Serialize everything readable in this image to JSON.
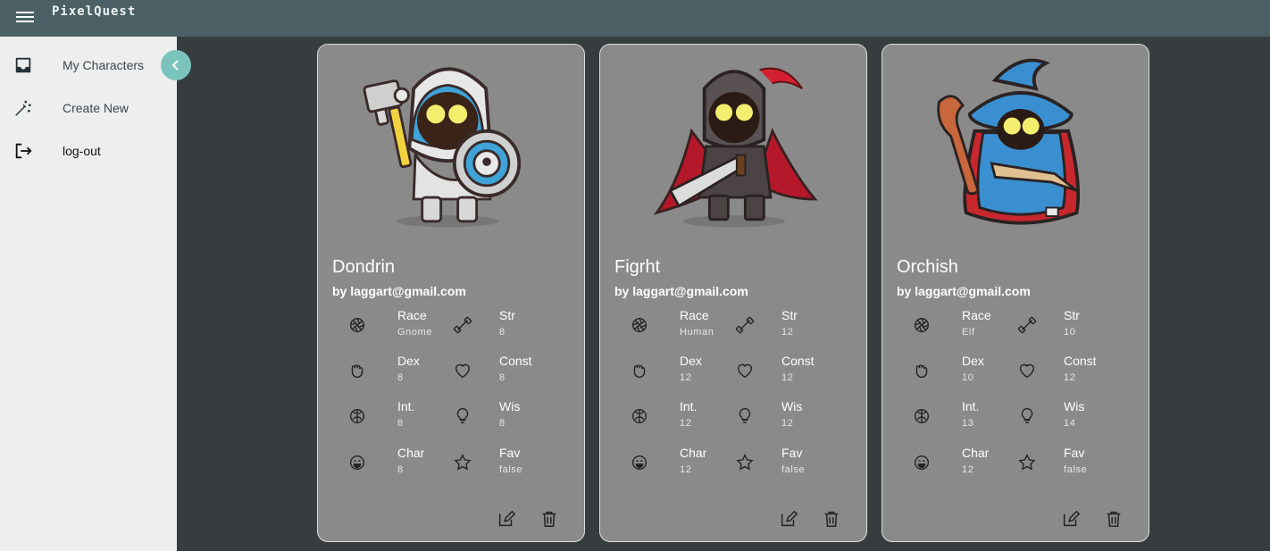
{
  "app": {
    "title": "PixelQuest"
  },
  "sidebar": {
    "items": [
      {
        "label": "My Characters",
        "icon": "inbox-icon"
      },
      {
        "label": "Create New",
        "icon": "magic-wand-icon"
      },
      {
        "label": "log-out",
        "icon": "logout-icon"
      }
    ],
    "collapse_icon": "chevron-left-icon"
  },
  "colors": {
    "topbar": "#4a6065",
    "sidebar": "#eeeeee",
    "accent": "#7bc4bd",
    "card": "#8a8a8a",
    "background": "#373c3e"
  },
  "cards": [
    {
      "name": "Dondrin",
      "owner": "by laggart@gmail.com",
      "portrait": "armored-paladin-with-hammer-and-shield",
      "stats": [
        {
          "label": "Race",
          "value": "Gnome",
          "icon": "aperture-icon"
        },
        {
          "label": "Str",
          "value": "8",
          "icon": "dumbbell-icon"
        },
        {
          "label": "Dex",
          "value": "8",
          "icon": "fist-icon"
        },
        {
          "label": "Const",
          "value": "8",
          "icon": "heart-icon"
        },
        {
          "label": "Int.",
          "value": "8",
          "icon": "brain-icon"
        },
        {
          "label": "Wis",
          "value": "8",
          "icon": "lightbulb-icon"
        },
        {
          "label": "Char",
          "value": "8",
          "icon": "smile-icon"
        },
        {
          "label": "Fav",
          "value": "false",
          "icon": "star-icon"
        }
      ]
    },
    {
      "name": "Figrht",
      "owner": "by laggart@gmail.com",
      "portrait": "armored-knight-with-sword-and-red-cape",
      "stats": [
        {
          "label": "Race",
          "value": "Human",
          "icon": "aperture-icon"
        },
        {
          "label": "Str",
          "value": "12",
          "icon": "dumbbell-icon"
        },
        {
          "label": "Dex",
          "value": "12",
          "icon": "fist-icon"
        },
        {
          "label": "Const",
          "value": "12",
          "icon": "heart-icon"
        },
        {
          "label": "Int.",
          "value": "12",
          "icon": "brain-icon"
        },
        {
          "label": "Wis",
          "value": "12",
          "icon": "lightbulb-icon"
        },
        {
          "label": "Char",
          "value": "12",
          "icon": "smile-icon"
        },
        {
          "label": "Fav",
          "value": "false",
          "icon": "star-icon"
        }
      ]
    },
    {
      "name": "Orchish",
      "owner": "by laggart@gmail.com",
      "portrait": "blue-robed-wizard-with-staff",
      "stats": [
        {
          "label": "Race",
          "value": "Elf",
          "icon": "aperture-icon"
        },
        {
          "label": "Str",
          "value": "10",
          "icon": "dumbbell-icon"
        },
        {
          "label": "Dex",
          "value": "10",
          "icon": "fist-icon"
        },
        {
          "label": "Const",
          "value": "12",
          "icon": "heart-icon"
        },
        {
          "label": "Int.",
          "value": "13",
          "icon": "brain-icon"
        },
        {
          "label": "Wis",
          "value": "14",
          "icon": "lightbulb-icon"
        },
        {
          "label": "Char",
          "value": "12",
          "icon": "smile-icon"
        },
        {
          "label": "Fav",
          "value": "false",
          "icon": "star-icon"
        }
      ]
    }
  ],
  "card_actions": {
    "edit_icon": "edit-icon",
    "delete_icon": "trash-icon"
  }
}
